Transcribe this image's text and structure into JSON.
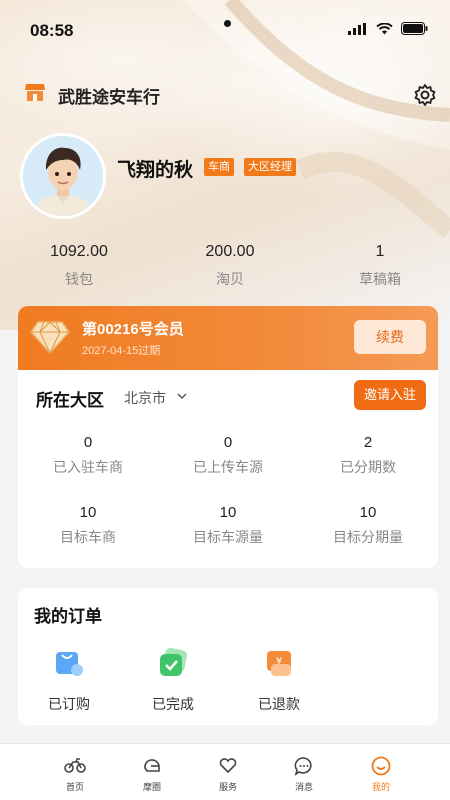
{
  "status_bar": {
    "time": "08:58"
  },
  "header": {
    "store_name": "武胜途安车行"
  },
  "profile": {
    "name": "飞翔的秋",
    "tags": [
      "车商",
      "大区经理"
    ]
  },
  "stats": [
    {
      "value": "1092.00",
      "label": "钱包"
    },
    {
      "value": "200.00",
      "label": "淘贝"
    },
    {
      "value": "1",
      "label": "草稿箱"
    }
  ],
  "membership": {
    "title": "第00216号会员",
    "expire": "2027-04-15过期",
    "renew_label": "续费"
  },
  "region": {
    "title": "所在大区",
    "city": "北京市",
    "invite_label": "邀请入驻",
    "metrics": [
      {
        "value": "0",
        "label": "已入驻车商"
      },
      {
        "value": "0",
        "label": "已上传车源"
      },
      {
        "value": "2",
        "label": "已分期数"
      },
      {
        "value": "10",
        "label": "目标车商"
      },
      {
        "value": "10",
        "label": "目标车源量"
      },
      {
        "value": "10",
        "label": "目标分期量"
      }
    ]
  },
  "orders": {
    "title": "我的订单",
    "items": [
      {
        "label": "已订购",
        "icon": "shopping-bag-icon"
      },
      {
        "label": "已完成",
        "icon": "check-icon"
      },
      {
        "label": "已退款",
        "icon": "refund-icon"
      }
    ]
  },
  "tabbar": {
    "items": [
      {
        "label": "首页",
        "icon": "motorcycle-icon"
      },
      {
        "label": "摩圈",
        "icon": "helmet-icon"
      },
      {
        "label": "服务",
        "icon": "heart-hand-icon"
      },
      {
        "label": "消息",
        "icon": "chat-icon"
      },
      {
        "label": "我的",
        "icon": "profile-icon",
        "active": true
      }
    ]
  },
  "colors": {
    "accent": "#f07a1a",
    "accent_dark": "#ef6b14",
    "background": "#f4f4f5"
  }
}
